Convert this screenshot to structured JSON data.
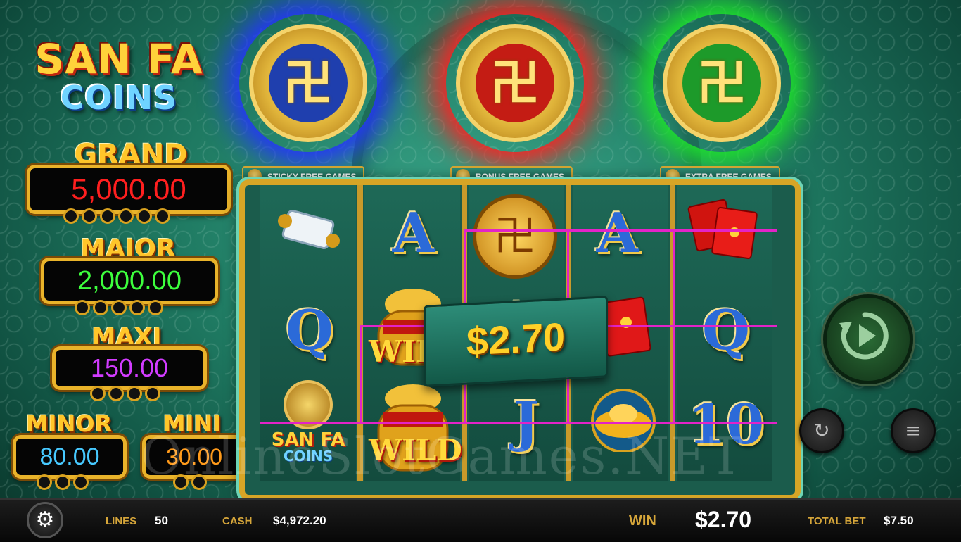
{
  "game": {
    "logo_line1": "SAN FA",
    "logo_line2": "COINS"
  },
  "jackpots": {
    "grand": {
      "label": "GRAND",
      "value": "5,000.00",
      "color": "#ff1f1f",
      "dots": 6
    },
    "major": {
      "label": "MAJOR",
      "value": "2,000.00",
      "color": "#3dff3d",
      "dots": 5
    },
    "maxi": {
      "label": "MAXI",
      "value": "150.00",
      "color": "#d23cff",
      "dots": 4
    },
    "minor": {
      "label": "MINOR",
      "value": "80.00",
      "color": "#47c9ff",
      "dots": 3
    },
    "mini": {
      "label": "MINI",
      "value": "30.00",
      "color": "#ff9a1a",
      "dots": 2
    }
  },
  "coins": [
    {
      "color": "blue",
      "glow": "#2433ff",
      "core": "#1f3fae"
    },
    {
      "color": "red",
      "glow": "#ff2020",
      "core": "#c41c14"
    },
    {
      "color": "green",
      "glow": "#1ee62a",
      "core": "#1d9a2a"
    }
  ],
  "features": {
    "sticky": "STICKY FREE GAMES",
    "bonus": "BONUS FREE GAMES",
    "extra": "EXTRA FREE GAMES"
  },
  "reels": {
    "reel1": [
      "scroll-icon",
      "Q",
      "san-fa-coins-logo"
    ],
    "reel2": [
      "A",
      "WILD",
      "WILD"
    ],
    "reel3": [
      "gold-coin-icon",
      "A",
      "J"
    ],
    "reel4": [
      "A",
      "red-envelope-icon",
      "gold-ingot-icon"
    ],
    "reel5": [
      "red-envelopes-icon",
      "Q",
      "10"
    ],
    "wild_label": "WILD",
    "logo_line1": "SAN FA",
    "logo_line2": "COINS"
  },
  "win_banner": "$2.70",
  "watermark": "OnlineSlotGames.NET",
  "bottom_bar": {
    "lines_label": "LINES",
    "lines_value": "50",
    "cash_label": "CASH",
    "cash_value": "$4,972.20",
    "win_label": "WIN",
    "win_value": "$2.70",
    "total_bet_label": "TOTAL BET",
    "total_bet_value": "$7.50"
  },
  "icons": {
    "settings": "gear-icon",
    "spin": "spin-icon",
    "autoplay": "autoplay-icon",
    "stake": "coin-stack-icon"
  }
}
